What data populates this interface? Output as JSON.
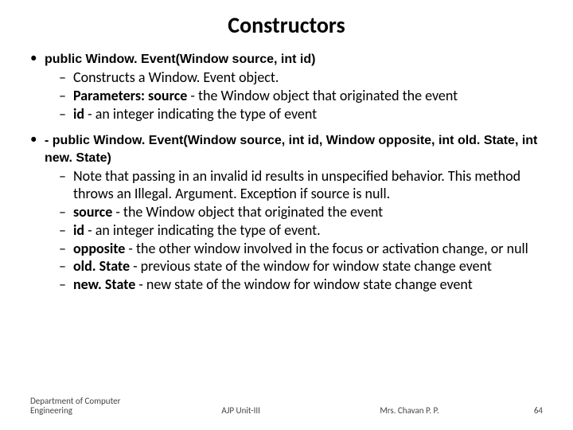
{
  "title": "Constructors",
  "items": [
    {
      "signature": "public Window. Event(Window source, int id)",
      "subs": [
        {
          "pre": "",
          "bold": "",
          "text": "Constructs a Window. Event object."
        },
        {
          "pre": "",
          "bold": "Parameters: source",
          "text": " - the Window object that originated the event"
        },
        {
          "pre": "",
          "bold": "id",
          "text": " - an integer indicating the type of event"
        }
      ]
    },
    {
      "signature": "- public Window. Event(Window source, int id, Window opposite, int old. State, int new. State)",
      "subs": [
        {
          "pre": "",
          "bold": "",
          "text": "Note that passing in an invalid id results in unspecified behavior. This method throws an Illegal. Argument. Exception if source is null."
        },
        {
          "pre": "",
          "bold": "source",
          "text": " - the Window object that originated the event"
        },
        {
          "pre": "",
          "bold": "id",
          "text": " - an integer indicating the type of event."
        },
        {
          "pre": "",
          "bold": "opposite",
          "text": " - the other window involved in the focus or activation change, or null"
        },
        {
          "pre": "",
          "bold": "old. State",
          "text": " - previous state of the window for window state change event"
        },
        {
          "pre": "",
          "bold": "new. State",
          "text": " - new state of the window for window state change event"
        }
      ]
    }
  ],
  "footer": {
    "dept": "Department of Computer Engineering",
    "unit": "AJP Unit-III",
    "author": "Mrs. Chavan P. P.",
    "page": "64"
  }
}
